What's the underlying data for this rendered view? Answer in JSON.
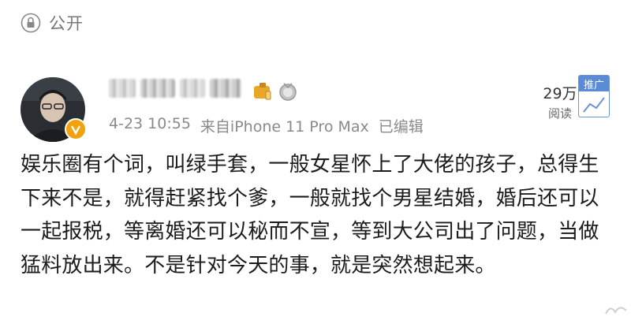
{
  "visibility": {
    "label": "公开",
    "icon": "lock-icon"
  },
  "author": {
    "avatar": "user-avatar",
    "verified_badge": "verified-v-icon"
  },
  "post_meta": {
    "date": "4-23 10:55",
    "source": "来自iPhone 11 Pro Max",
    "edited": "已编辑"
  },
  "stats": {
    "read_count": "29万",
    "read_label": "阅读"
  },
  "promote": {
    "label": "推广"
  },
  "post": {
    "text": "娱乐圈有个词，叫绿手套，一般女星怀上了大佬的孩子，总得生下来不是，就得赶紧找个爹，一般就找个男星结婚，婚后还可以一起报税，等离婚还可以秘而不宣，等到大公司出了问题，当做猛料放出来。不是针对今天的事，就是突然想起来。"
  },
  "colors": {
    "badge": "#f2a20c",
    "promote": "#5b8ad6",
    "meta_text": "#8a8a8a"
  }
}
